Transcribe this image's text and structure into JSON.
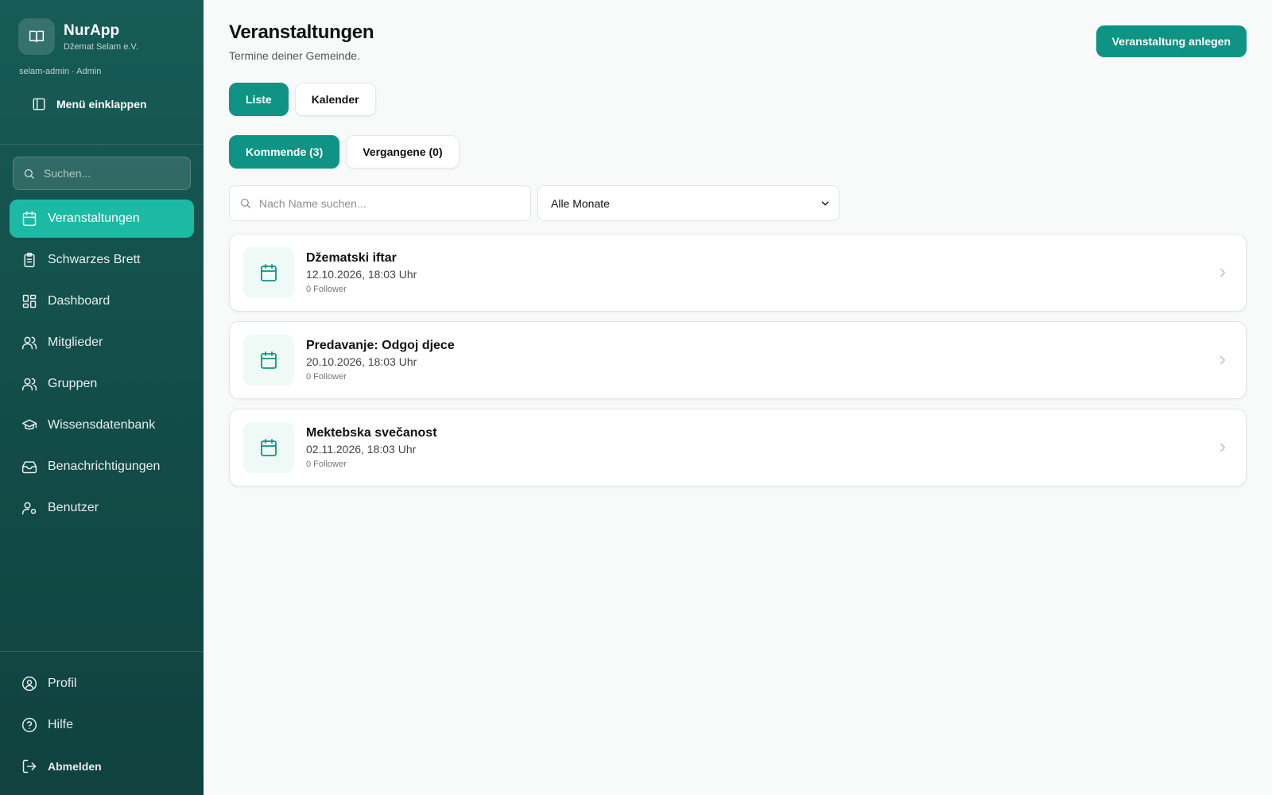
{
  "app": {
    "name": "NurApp",
    "org": "Džemat Selam e.V.",
    "user_line": "selam-admin · Admin",
    "collapse_label": "Menü einklappen"
  },
  "sidebar": {
    "search_placeholder": "Suchen...",
    "items": [
      {
        "label": "Veranstaltungen",
        "icon": "calendar-icon",
        "active": true
      },
      {
        "label": "Schwarzes Brett",
        "icon": "clipboard-icon",
        "active": false
      },
      {
        "label": "Dashboard",
        "icon": "dashboard-icon",
        "active": false
      },
      {
        "label": "Mitglieder",
        "icon": "users-icon",
        "active": false
      },
      {
        "label": "Gruppen",
        "icon": "users-icon",
        "active": false
      },
      {
        "label": "Wissensdatenbank",
        "icon": "graduation-cap-icon",
        "active": false
      },
      {
        "label": "Benachrichtigungen",
        "icon": "inbox-icon",
        "active": false
      },
      {
        "label": "Benutzer",
        "icon": "user-cog-icon",
        "active": false
      }
    ],
    "bottom": [
      {
        "label": "Profil",
        "icon": "user-circle-icon"
      },
      {
        "label": "Hilfe",
        "icon": "help-circle-icon"
      },
      {
        "label": "Abmelden",
        "icon": "logout-icon"
      }
    ]
  },
  "header": {
    "title": "Veranstaltungen",
    "subtitle": "Termine deiner Gemeinde.",
    "create_button": "Veranstaltung anlegen"
  },
  "view_toggle": {
    "list": "Liste",
    "calendar": "Kalender",
    "selected": "Liste"
  },
  "tabs": {
    "upcoming": "Kommende (3)",
    "past": "Vergangene (0)",
    "selected": "upcoming"
  },
  "filters": {
    "search_placeholder": "Nach Name suchen...",
    "month_selected": "Alle Monate"
  },
  "events": [
    {
      "name": "Džematski iftar",
      "datetime": "12.10.2026, 18:03 Uhr",
      "followers": "0 Follower"
    },
    {
      "name": "Predavanje: Odgoj djece",
      "datetime": "20.10.2026, 18:03 Uhr",
      "followers": "0 Follower"
    },
    {
      "name": "Mektebska svečanost",
      "datetime": "02.11.2026, 18:03 Uhr",
      "followers": "0 Follower"
    }
  ],
  "colors": {
    "sidebar_bg": "#175c56",
    "accent": "#0e9384",
    "active_nav": "#1cb9a4"
  }
}
